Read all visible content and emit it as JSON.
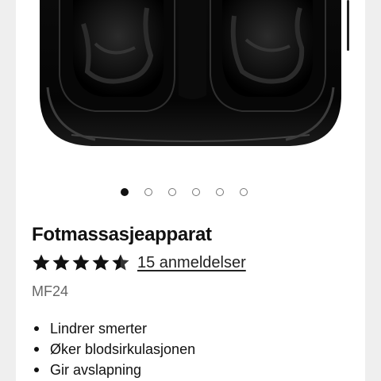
{
  "product": {
    "title": "Fotmassasjeapparat",
    "rating": 4.5,
    "reviews_text": "15 anmeldelser",
    "sku": "MF24",
    "features": [
      "Lindrer smerter",
      "Øker blodsirkulasjonen",
      "Gir avslapning"
    ]
  },
  "gallery": {
    "image_count": 6,
    "active_index": 0
  },
  "colors": {
    "background": "#efefef",
    "card": "#ffffff",
    "text": "#111111",
    "muted": "#666666"
  }
}
